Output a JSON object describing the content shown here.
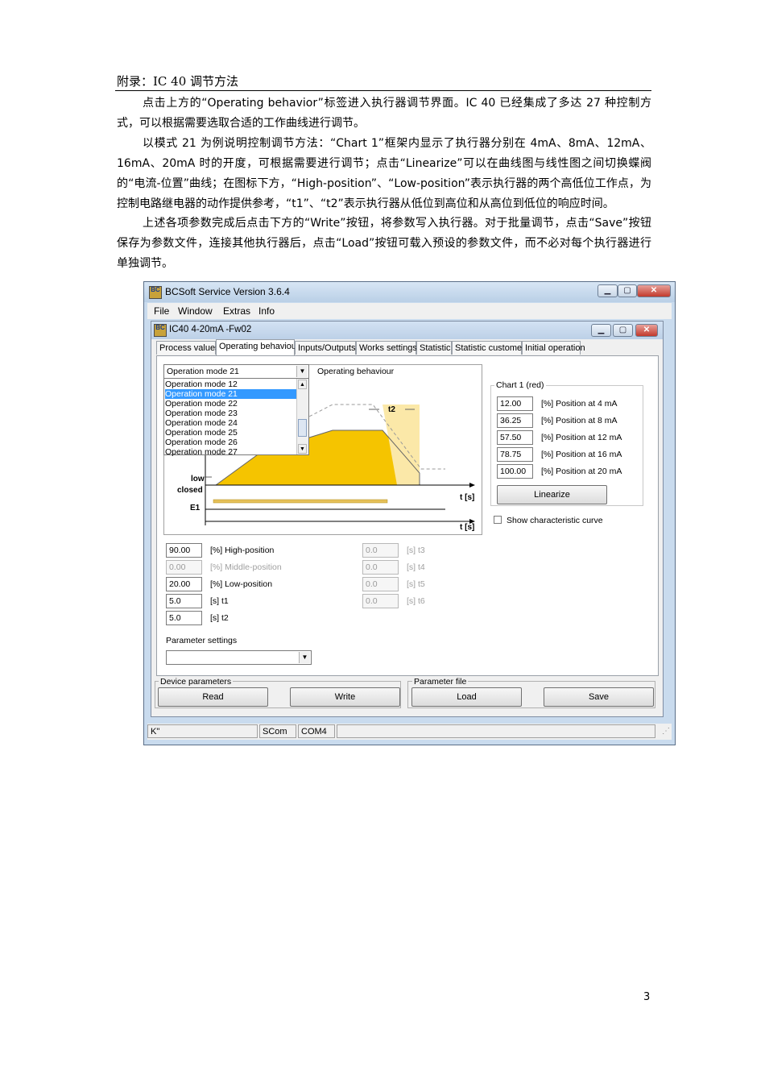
{
  "doc": {
    "header": "附录：IC 40 调节方法",
    "paragraphs": [
      "点击上方的“Operating behavior”标签进入执行器调节界面。IC 40 已经集成了多达 27 种控制方式，可以根据需要选取合适的工作曲线进行调节。",
      "以模式 21 为例说明控制调节方法：“Chart 1”框架内显示了执行器分别在 4mA、8mA、12mA、16mA、20mA 时的开度，可根据需要进行调节；点击“Linearize”可以在曲线图与线性图之间切换蝶阀的“电流-位置”曲线；在图标下方，“High-position”、“Low-position”表示执行器的两个高低位工作点，为控制电路继电器的动作提供参考，“t1”、“t2”表示执行器从低位到高位和从高位到低位的响应时间。",
      "上述各项参数完成后点击下方的“Write”按钮，将参数写入执行器。对于批量调节，点击“Save”按钮保存为参数文件，连接其他执行器后，点击“Load”按钮可载入预设的参数文件，而不必对每个执行器进行单独调节。"
    ],
    "page_number": "3"
  },
  "app": {
    "title": "BCSoft Service Version 3.6.4",
    "icon_text": "BC",
    "menu": [
      "File",
      "Window",
      "Extras",
      "Info"
    ],
    "child_title": "IC40 4-20mA -Fw02",
    "tabs": [
      "Process values",
      "Operating behaviour",
      "Inputs/Outputs",
      "Works settings",
      "Statistic",
      "Statistic customer",
      "Initial operation"
    ],
    "mode_select": "Operation mode 21",
    "mode_label": "Operating behaviour",
    "mode_options": [
      "Operation mode 12",
      "Operation mode 21",
      "Operation mode 22",
      "Operation mode 23",
      "Operation mode 24",
      "Operation mode 25",
      "Operation mode 26",
      "Operation mode 27"
    ],
    "chart_labels": {
      "t2": "t2",
      "low": "low",
      "closed": "closed",
      "ts1": "t [s]",
      "e1": "E1",
      "ts2": "t [s]"
    },
    "chart1": {
      "title": "Chart 1 (red)",
      "rows": [
        {
          "value": "12.00",
          "label": "[%] Position at 4 mA"
        },
        {
          "value": "36.25",
          "label": "[%] Position at 8 mA"
        },
        {
          "value": "57.50",
          "label": "[%] Position at 12 mA"
        },
        {
          "value": "78.75",
          "label": "[%] Position at 16 mA"
        },
        {
          "value": "100.00",
          "label": "[%] Position at 20 mA"
        }
      ],
      "linearize": "Linearize"
    },
    "show_curve": "Show characteristic curve",
    "params_left": [
      {
        "value": "90.00",
        "label": "[%] High-position",
        "enabled": true
      },
      {
        "value": "0.00",
        "label": "[%] Middle-position",
        "enabled": false
      },
      {
        "value": "20.00",
        "label": "[%] Low-position",
        "enabled": true
      },
      {
        "value": "5.0",
        "label": "[s] t1",
        "enabled": true
      },
      {
        "value": "5.0",
        "label": "[s] t2",
        "enabled": true
      }
    ],
    "params_right": [
      {
        "value": "0.0",
        "label": "[s] t3"
      },
      {
        "value": "0.0",
        "label": "[s] t4"
      },
      {
        "value": "0.0",
        "label": "[s] t5"
      },
      {
        "value": "0.0",
        "label": "[s] t6"
      }
    ],
    "param_settings_label": "Parameter settings",
    "device_params": {
      "label": "Device parameters",
      "read": "Read",
      "write": "Write"
    },
    "param_file": {
      "label": "Parameter file",
      "load": "Load",
      "save": "Save"
    },
    "status": [
      "K\"",
      "SCom",
      "COM4"
    ],
    "colors": {
      "fill": "#f5c400",
      "fill_light": "#fbe8a8",
      "selection": "#3399ff"
    }
  }
}
